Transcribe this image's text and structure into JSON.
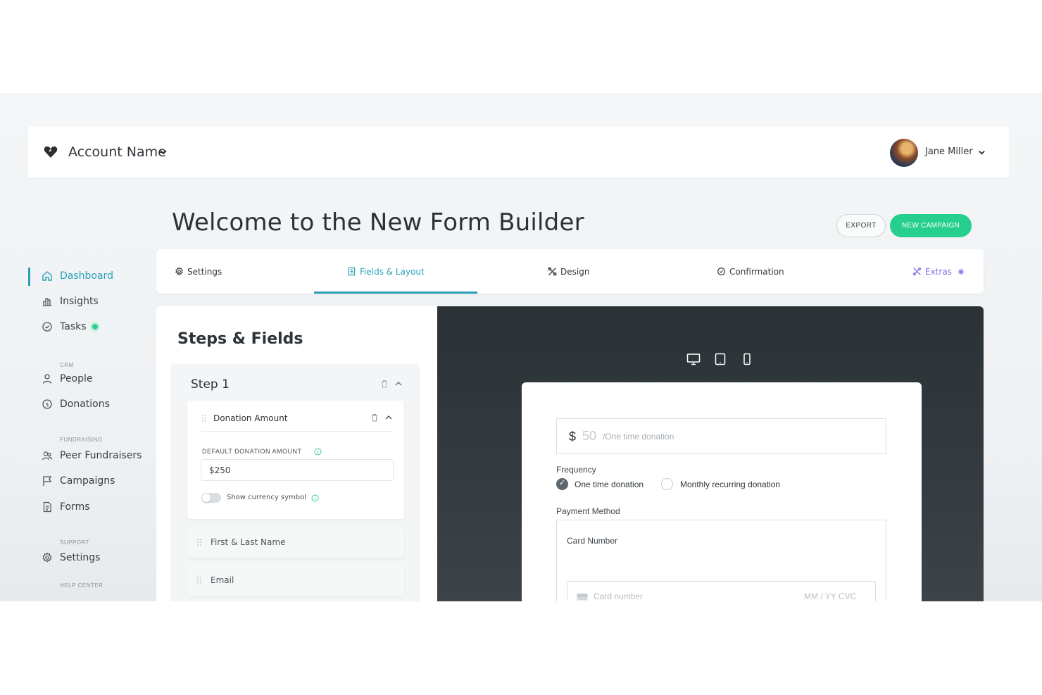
{
  "header": {
    "account_name": "Account Name",
    "user_name": "Jane Miller"
  },
  "page": {
    "title": "Welcome to the New Form Builder",
    "export_label": "EXPORT",
    "new_campaign_label": "NEW CAMPAIGN"
  },
  "sidebar": {
    "items": [
      {
        "label": "Dashboard",
        "icon": "home-icon",
        "active": true
      },
      {
        "label": "Insights",
        "icon": "bar-chart-icon"
      },
      {
        "label": "Tasks",
        "icon": "check-circle-icon",
        "badge_dot": true
      },
      {
        "label": "People",
        "icon": "person-icon"
      },
      {
        "label": "Donations",
        "icon": "dollar-circle-icon"
      },
      {
        "label": "Peer Fundraisers",
        "icon": "people-icon"
      },
      {
        "label": "Campaigns",
        "icon": "flag-icon"
      },
      {
        "label": "Forms",
        "icon": "document-icon"
      },
      {
        "label": "Settings",
        "icon": "gear-icon"
      }
    ],
    "sections": {
      "crm": "CRM",
      "fundraising": "FUNDRAISING",
      "support": "SUPPORT",
      "help_center": "HELP CENTER"
    }
  },
  "tabs": [
    {
      "label": "Settings",
      "icon": "gear-icon"
    },
    {
      "label": "Fields & Layout",
      "icon": "layout-icon",
      "active": true
    },
    {
      "label": "Design",
      "icon": "design-tools-icon"
    },
    {
      "label": "Confirmation",
      "icon": "check-circle-icon"
    },
    {
      "label": "Extras",
      "icon": "extras-icon"
    }
  ],
  "fields_panel": {
    "title": "Steps & Fields",
    "step_title": "Step 1",
    "donation_field": {
      "name": "Donation Amount",
      "default_label": "DEFAULT DONATION AMOUNT",
      "default_value": "$250",
      "toggle_label": "Show currency symbol",
      "toggle_on": false
    },
    "other_fields": [
      "First & Last Name",
      "Email"
    ]
  },
  "preview": {
    "currency_symbol": "$",
    "amount_placeholder": "50",
    "amount_note": "/One time donation",
    "frequency_label": "Frequency",
    "frequency_options": [
      {
        "label": "One time donation",
        "checked": true
      },
      {
        "label": "Monthly recurring donation",
        "checked": false
      }
    ],
    "payment_label": "Payment Method",
    "card_number_label": "Card Number",
    "card_placeholder": "Card number",
    "card_expiry_placeholder": "MM / YY  CVC"
  },
  "colors": {
    "accent": "#2aa0b8",
    "primary_button": "#27cf8f",
    "extras": "#8b6fe0",
    "preview_bg": "#2b3236"
  }
}
